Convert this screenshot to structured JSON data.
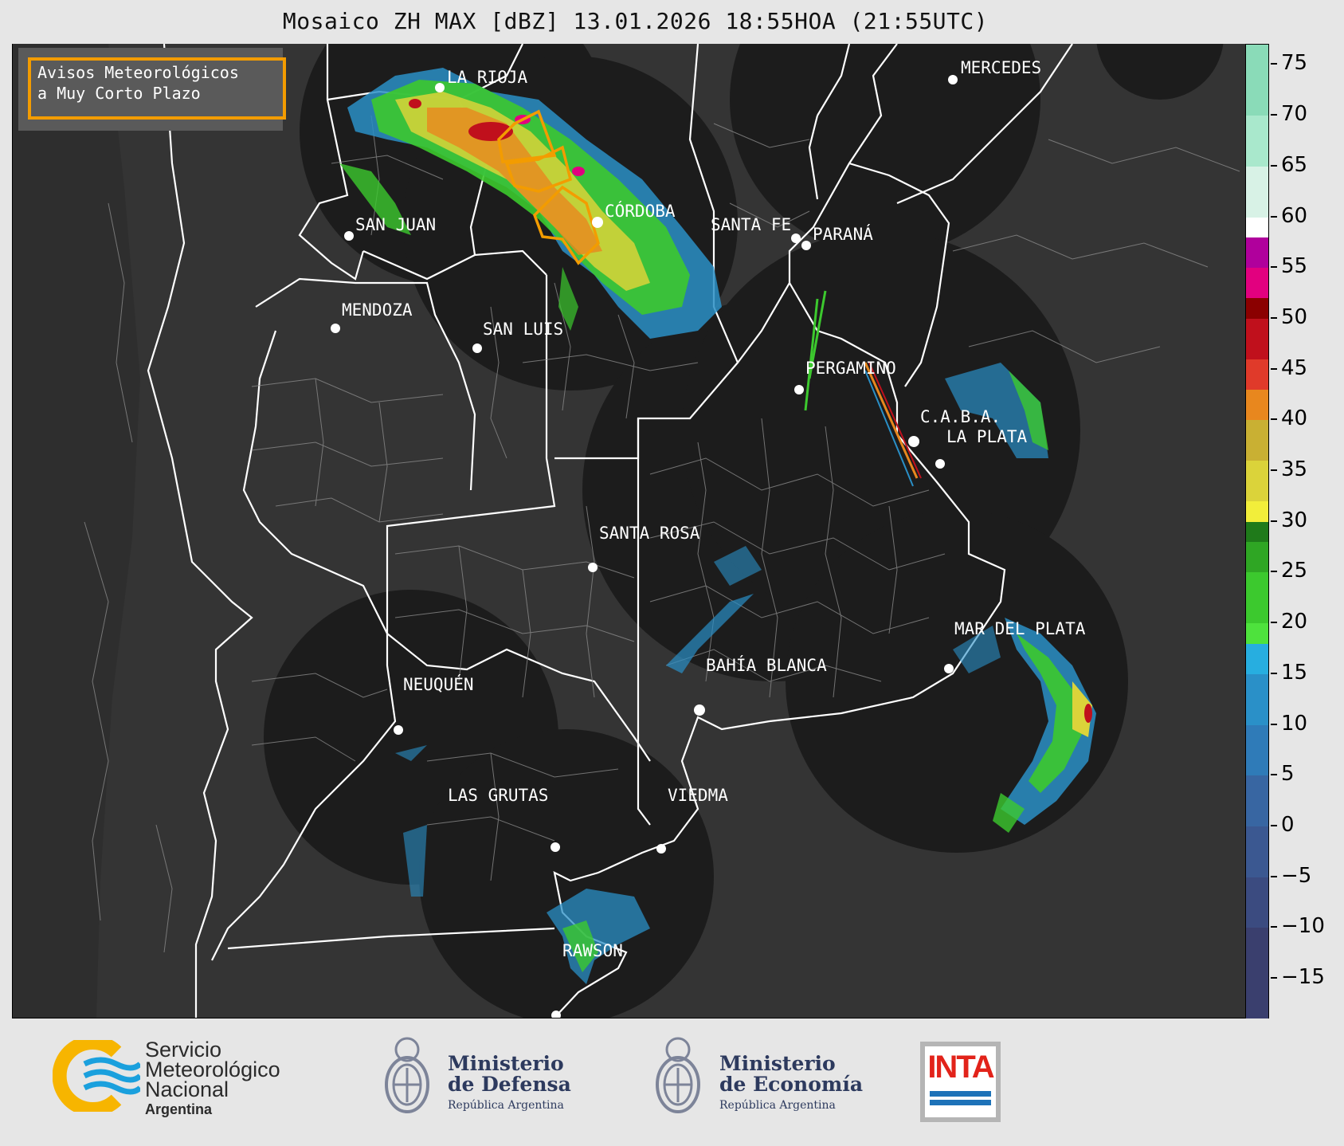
{
  "title": "Mosaico ZH MAX [dBZ] 13.01.2026 18:55HOA (21:55UTC)",
  "warning_box": {
    "line1": "Avisos Meteorológicos",
    "line2": "a Muy Corto Plazo"
  },
  "cities": [
    {
      "name": "LA RIOJA"
    },
    {
      "name": "MERCEDES"
    },
    {
      "name": "SAN JUAN"
    },
    {
      "name": "CÓRDOBA"
    },
    {
      "name": "SANTA FE"
    },
    {
      "name": "PARANÁ"
    },
    {
      "name": "MENDOZA"
    },
    {
      "name": "SAN LUIS"
    },
    {
      "name": "PERGAMINO"
    },
    {
      "name": "C.A.B.A."
    },
    {
      "name": "LA PLATA"
    },
    {
      "name": "SANTA ROSA"
    },
    {
      "name": "MAR DEL PLATA"
    },
    {
      "name": "BAHÍA BLANCA"
    },
    {
      "name": "NEUQUÉN"
    },
    {
      "name": "LAS GRUTAS"
    },
    {
      "name": "VIEDMA"
    },
    {
      "name": "RAWSON"
    }
  ],
  "colorbar": {
    "unit": "dBZ",
    "min": -19,
    "max": 77,
    "ticks": [
      "75",
      "70",
      "65",
      "60",
      "55",
      "50",
      "45",
      "40",
      "35",
      "30",
      "25",
      "20",
      "15",
      "10",
      "5",
      "0",
      "−5",
      "−10",
      "−15"
    ],
    "colors": [
      {
        "from": -19,
        "to": -10,
        "color": "#3a3f6e"
      },
      {
        "from": -10,
        "to": -5,
        "color": "#3b4b80"
      },
      {
        "from": -5,
        "to": 0,
        "color": "#3b5891"
      },
      {
        "from": 0,
        "to": 5,
        "color": "#3866a2"
      },
      {
        "from": 5,
        "to": 10,
        "color": "#2f7bb8"
      },
      {
        "from": 10,
        "to": 15,
        "color": "#2a90c8"
      },
      {
        "from": 15,
        "to": 18,
        "color": "#27aee0"
      },
      {
        "from": 18,
        "to": 20,
        "color": "#4ee23d"
      },
      {
        "from": 20,
        "to": 25,
        "color": "#3cc92e"
      },
      {
        "from": 25,
        "to": 28,
        "color": "#2fa624"
      },
      {
        "from": 28,
        "to": 30,
        "color": "#1f7a1a"
      },
      {
        "from": 30,
        "to": 32,
        "color": "#f2ee3a"
      },
      {
        "from": 32,
        "to": 36,
        "color": "#dbd33a"
      },
      {
        "from": 36,
        "to": 40,
        "color": "#c9b033"
      },
      {
        "from": 40,
        "to": 43,
        "color": "#e8871e"
      },
      {
        "from": 43,
        "to": 46,
        "color": "#e03a2a"
      },
      {
        "from": 46,
        "to": 50,
        "color": "#c0101c"
      },
      {
        "from": 50,
        "to": 52,
        "color": "#8b0000"
      },
      {
        "from": 52,
        "to": 55,
        "color": "#e2007f"
      },
      {
        "from": 55,
        "to": 58,
        "color": "#b0009c"
      },
      {
        "from": 58,
        "to": 60,
        "color": "#ffffff"
      },
      {
        "from": 60,
        "to": 65,
        "color": "#d8f2e6"
      },
      {
        "from": 65,
        "to": 70,
        "color": "#a9e8cc"
      },
      {
        "from": 70,
        "to": 77,
        "color": "#8adbb8"
      }
    ]
  },
  "footer": {
    "smn": {
      "line1": "Servicio",
      "line2": "Meteorológico",
      "line3": "Nacional",
      "line4": "Argentina"
    },
    "defensa": {
      "line1": "Ministerio",
      "line2": "de Defensa",
      "line3": "República Argentina"
    },
    "economia": {
      "line1": "Ministerio",
      "line2": "de Economía",
      "line3": "República Argentina"
    },
    "inta": {
      "label": "INTA"
    }
  }
}
